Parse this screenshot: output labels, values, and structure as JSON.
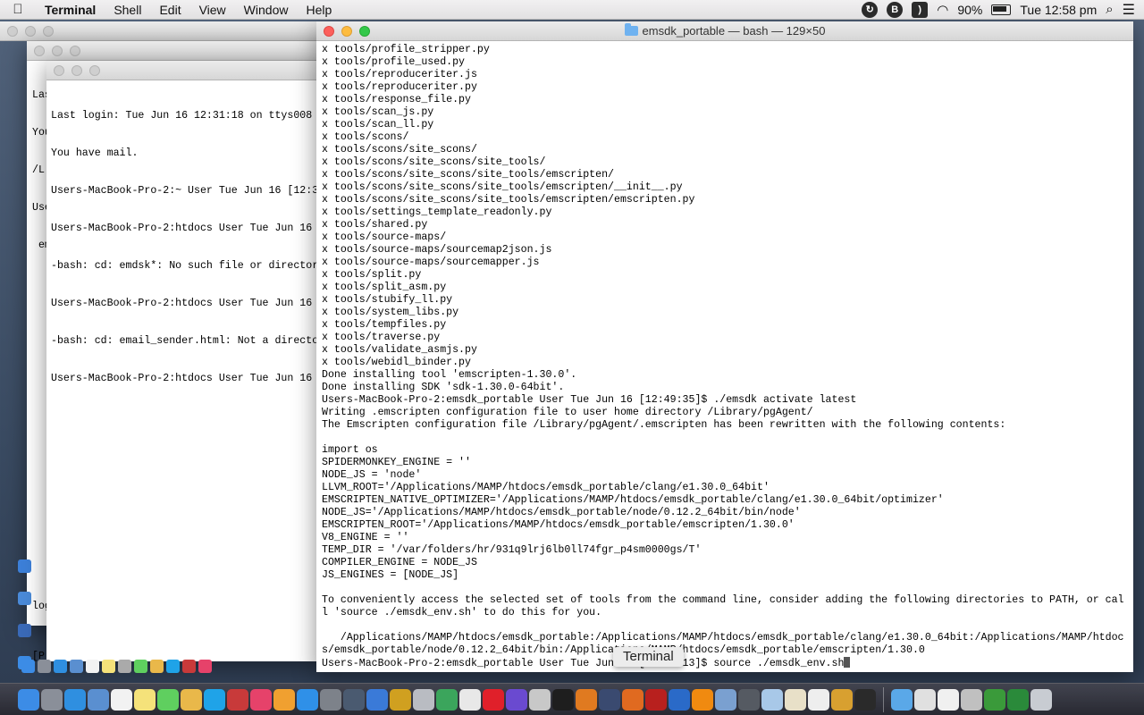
{
  "menubar": {
    "app_name": "Terminal",
    "items": [
      "Shell",
      "Edit",
      "View",
      "Window",
      "Help"
    ],
    "battery": "90%",
    "clock": "Tue 12:58 pm"
  },
  "back_window": {
    "lines": [
      "Las",
      "You",
      "/L",
      "Use",
      " em"
    ],
    "bottom_lines": [
      "log",
      "[P"
    ]
  },
  "mid_window": {
    "lines": [
      "Last login: Tue Jun 16 12:31:18 on ttys008",
      "You have mail.",
      "Users-MacBook-Pro-2:~ User Tue Jun 16 [12:3",
      "Users-MacBook-Pro-2:htdocs User Tue Jun 16",
      "-bash: cd: emdsk*: No such file or director",
      "Users-MacBook-Pro-2:htdocs User Tue Jun 16",
      "-bash: cd: email_sender.html: Not a directo",
      "Users-MacBook-Pro-2:htdocs User Tue Jun 16"
    ]
  },
  "main_window": {
    "title": "emsdk_portable — bash — 129×50",
    "lines": [
      "x tools/profile_stripper.py",
      "x tools/profile_used.py",
      "x tools/reproduceriter.js",
      "x tools/reproduceriter.py",
      "x tools/response_file.py",
      "x tools/scan_js.py",
      "x tools/scan_ll.py",
      "x tools/scons/",
      "x tools/scons/site_scons/",
      "x tools/scons/site_scons/site_tools/",
      "x tools/scons/site_scons/site_tools/emscripten/",
      "x tools/scons/site_scons/site_tools/emscripten/__init__.py",
      "x tools/scons/site_scons/site_tools/emscripten/emscripten.py",
      "x tools/settings_template_readonly.py",
      "x tools/shared.py",
      "x tools/source-maps/",
      "x tools/source-maps/sourcemap2json.js",
      "x tools/source-maps/sourcemapper.js",
      "x tools/split.py",
      "x tools/split_asm.py",
      "x tools/stubify_ll.py",
      "x tools/system_libs.py",
      "x tools/tempfiles.py",
      "x tools/traverse.py",
      "x tools/validate_asmjs.py",
      "x tools/webidl_binder.py",
      "Done installing tool 'emscripten-1.30.0'.",
      "Done installing SDK 'sdk-1.30.0-64bit'.",
      "Users-MacBook-Pro-2:emsdk_portable User Tue Jun 16 [12:49:35]$ ./emsdk activate latest",
      "Writing .emscripten configuration file to user home directory /Library/pgAgent/",
      "The Emscripten configuration file /Library/pgAgent/.emscripten has been rewritten with the following contents:",
      "",
      "import os",
      "SPIDERMONKEY_ENGINE = ''",
      "NODE_JS = 'node'",
      "LLVM_ROOT='/Applications/MAMP/htdocs/emsdk_portable/clang/e1.30.0_64bit'",
      "EMSCRIPTEN_NATIVE_OPTIMIZER='/Applications/MAMP/htdocs/emsdk_portable/clang/e1.30.0_64bit/optimizer'",
      "NODE_JS='/Applications/MAMP/htdocs/emsdk_portable/node/0.12.2_64bit/bin/node'",
      "EMSCRIPTEN_ROOT='/Applications/MAMP/htdocs/emsdk_portable/emscripten/1.30.0'",
      "V8_ENGINE = ''",
      "TEMP_DIR = '/var/folders/hr/931q9lrj6lb0ll74fgr_p4sm0000gs/T'",
      "COMPILER_ENGINE = NODE_JS",
      "JS_ENGINES = [NODE_JS]",
      "",
      "To conveniently access the selected set of tools from the command line, consider adding the following directories to PATH, or cal",
      "l 'source ./emsdk_env.sh' to do this for you.",
      "",
      "   /Applications/MAMP/htdocs/emsdk_portable:/Applications/MAMP/htdocs/emsdk_portable/clang/e1.30.0_64bit:/Applications/MAMP/htdoc",
      "s/emsdk_portable/node/0.12.2_64bit/bin:/Applications/MAMP/htdocs/emsdk_portable/emscripten/1.30.0",
      "Users-MacBook-Pro-2:emsdk_portable User Tue Jun 16 [12:58:13]$ source ./emsdk_env.sh"
    ]
  },
  "tooltip": "Terminal",
  "dock": {
    "icons": [
      {
        "name": "finder-icon",
        "color": "#3c8ce6"
      },
      {
        "name": "launchpad-icon",
        "color": "#8a8f99"
      },
      {
        "name": "safari-icon",
        "color": "#2f8fe0"
      },
      {
        "name": "preview-icon",
        "color": "#5a8fd0"
      },
      {
        "name": "calendar-icon",
        "color": "#f2f2f2"
      },
      {
        "name": "notes-icon",
        "color": "#f5e27a"
      },
      {
        "name": "messages-icon",
        "color": "#5fcf5f"
      },
      {
        "name": "photos-icon",
        "color": "#e9b84a"
      },
      {
        "name": "skype-icon",
        "color": "#1fa3e8"
      },
      {
        "name": "photo-booth-icon",
        "color": "#c83a3a"
      },
      {
        "name": "itunes-icon",
        "color": "#e6426a"
      },
      {
        "name": "ibooks-icon",
        "color": "#f0a030"
      },
      {
        "name": "app-store-icon",
        "color": "#2f90e8"
      },
      {
        "name": "system-preferences-icon",
        "color": "#7d828a"
      },
      {
        "name": "utilities-icon",
        "color": "#4a5a70"
      },
      {
        "name": "xcode-icon",
        "color": "#3a7ad8"
      },
      {
        "name": "filezilla-icon",
        "color": "#d0a020"
      },
      {
        "name": "disk-utility-icon",
        "color": "#b9bcc2"
      },
      {
        "name": "chrome-icon",
        "color": "#3ba55c"
      },
      {
        "name": "document-icon",
        "color": "#e8e8e8"
      },
      {
        "name": "opera-icon",
        "color": "#e0202a"
      },
      {
        "name": "imovie-icon",
        "color": "#6a4ad0"
      },
      {
        "name": "archive-icon",
        "color": "#c8c8c8"
      },
      {
        "name": "terminal-icon",
        "color": "#1e1e1e"
      },
      {
        "name": "tools-icon",
        "color": "#e07a20"
      },
      {
        "name": "bbedit-icon",
        "color": "#3a4a70"
      },
      {
        "name": "firefox-icon",
        "color": "#e06a20"
      },
      {
        "name": "filezilla-icon",
        "color": "#b8201e"
      },
      {
        "name": "edge-icon",
        "color": "#2a6ac8"
      },
      {
        "name": "vlc-icon",
        "color": "#f08a10"
      },
      {
        "name": "screen-icon",
        "color": "#7aa0d0"
      },
      {
        "name": "help-icon",
        "color": "#555a62"
      },
      {
        "name": "box-icon",
        "color": "#a8c8e8"
      },
      {
        "name": "script-icon",
        "color": "#e8e0c8"
      },
      {
        "name": "page-icon",
        "color": "#eeeeee"
      },
      {
        "name": "tool-icon",
        "color": "#d8a030"
      },
      {
        "name": "console-icon",
        "color": "#2a2a2a"
      }
    ],
    "right_icons": [
      {
        "name": "folder-icon",
        "color": "#5aa8e8"
      },
      {
        "name": "stack-icon",
        "color": "#e0e0e0"
      },
      {
        "name": "document-stack-icon",
        "color": "#f0f0f0"
      },
      {
        "name": "screenshot-icon",
        "color": "#c0c0c0"
      },
      {
        "name": "green-app-icon",
        "color": "#3a9a3a"
      },
      {
        "name": "monitor-icon",
        "color": "#2a8a3a"
      },
      {
        "name": "trash-icon",
        "color": "#c8ccd2"
      }
    ]
  }
}
